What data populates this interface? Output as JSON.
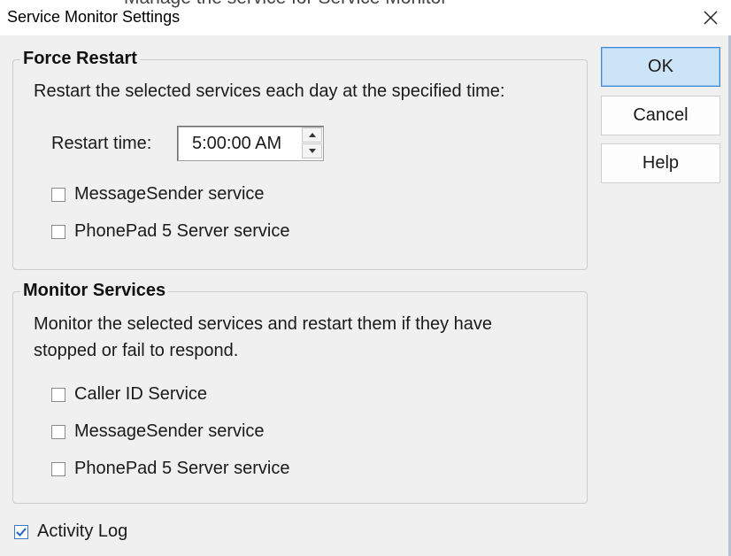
{
  "window": {
    "title": "Service Monitor Settings",
    "background_text": "Manage the service for Service Monitor"
  },
  "force_restart": {
    "title": "Force Restart",
    "description": "Restart the selected services each day at the specified time:",
    "restart_time_label": "Restart time:",
    "restart_time_value": "5:00:00 AM",
    "services": [
      {
        "label": "MessageSender service",
        "checked": false
      },
      {
        "label": "PhonePad 5 Server service",
        "checked": false
      }
    ]
  },
  "monitor_services": {
    "title": "Monitor Services",
    "description_line1": "Monitor the selected services and restart them if they have",
    "description_line2": "stopped or fail to respond.",
    "services": [
      {
        "label": "Caller ID Service",
        "checked": false
      },
      {
        "label": "MessageSender service",
        "checked": false
      },
      {
        "label": "PhonePad 5 Server service",
        "checked": false
      }
    ]
  },
  "activity_log": {
    "label": "Activity Log",
    "checked": true
  },
  "buttons": {
    "ok": "OK",
    "cancel": "Cancel",
    "help": "Help"
  },
  "colors": {
    "accent": "#3b8bd9",
    "default_button_bg": "#cce4f7",
    "check_mark": "#1b64c4"
  },
  "icons": {
    "close": "close-icon",
    "spin_up": "spin-up-arrow-icon",
    "spin_down": "spin-down-arrow-icon",
    "check": "checkmark-icon"
  }
}
